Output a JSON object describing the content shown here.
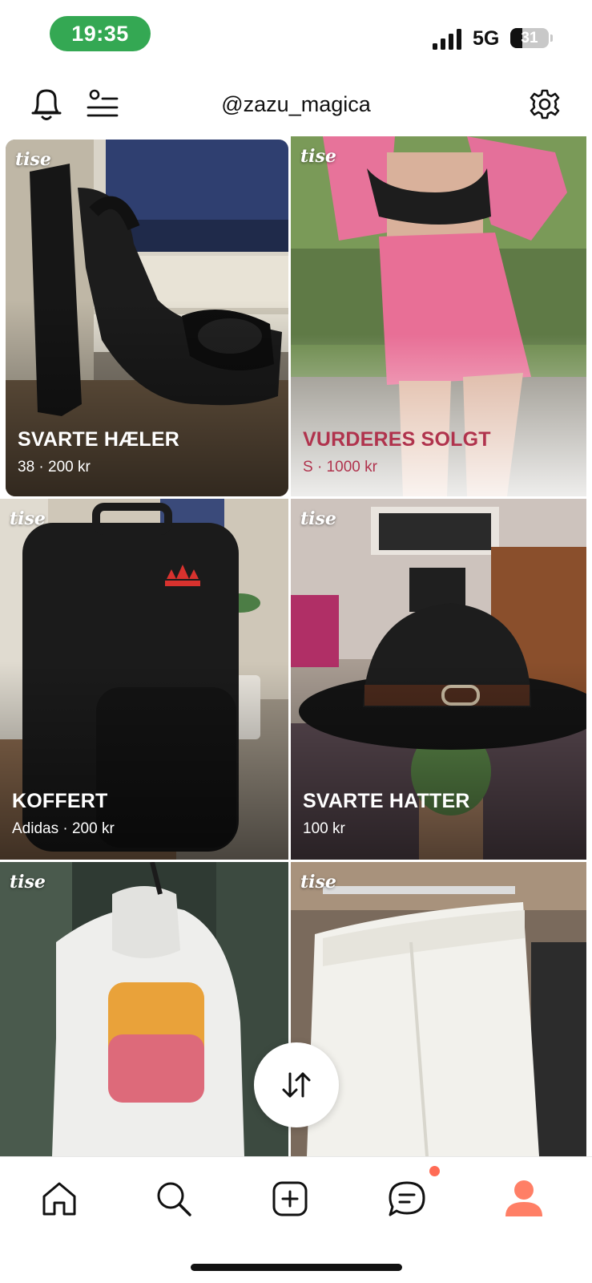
{
  "status": {
    "time": "19:35",
    "network": "5G",
    "battery_level": "31",
    "battery_fraction": 0.31
  },
  "header": {
    "title": "@zazu_magica",
    "icons": [
      "bell-icon",
      "filter-list-icon",
      "gear-icon"
    ]
  },
  "colors": {
    "accent": "#ff7f66",
    "status_green": "#34a853",
    "sold_text": "#b0334d"
  },
  "listings": [
    {
      "brand": "tise",
      "title": "SVARTE HÆLER",
      "meta": "38 · 200 kr"
    },
    {
      "brand": "tise",
      "title": "VURDERES SOLGT",
      "meta": "S · 1000 kr"
    },
    {
      "brand": "tise",
      "title": "KOFFERT",
      "meta": "Adidas · 200 kr"
    },
    {
      "brand": "tise",
      "title": "SVARTE HATTER",
      "meta": "100 kr"
    },
    {
      "brand": "tise"
    },
    {
      "brand": "tise"
    }
  ],
  "nav": {
    "items": [
      "home-icon",
      "search-icon",
      "add-listing-icon",
      "messages-icon",
      "profile-icon"
    ],
    "active": "profile-icon"
  }
}
